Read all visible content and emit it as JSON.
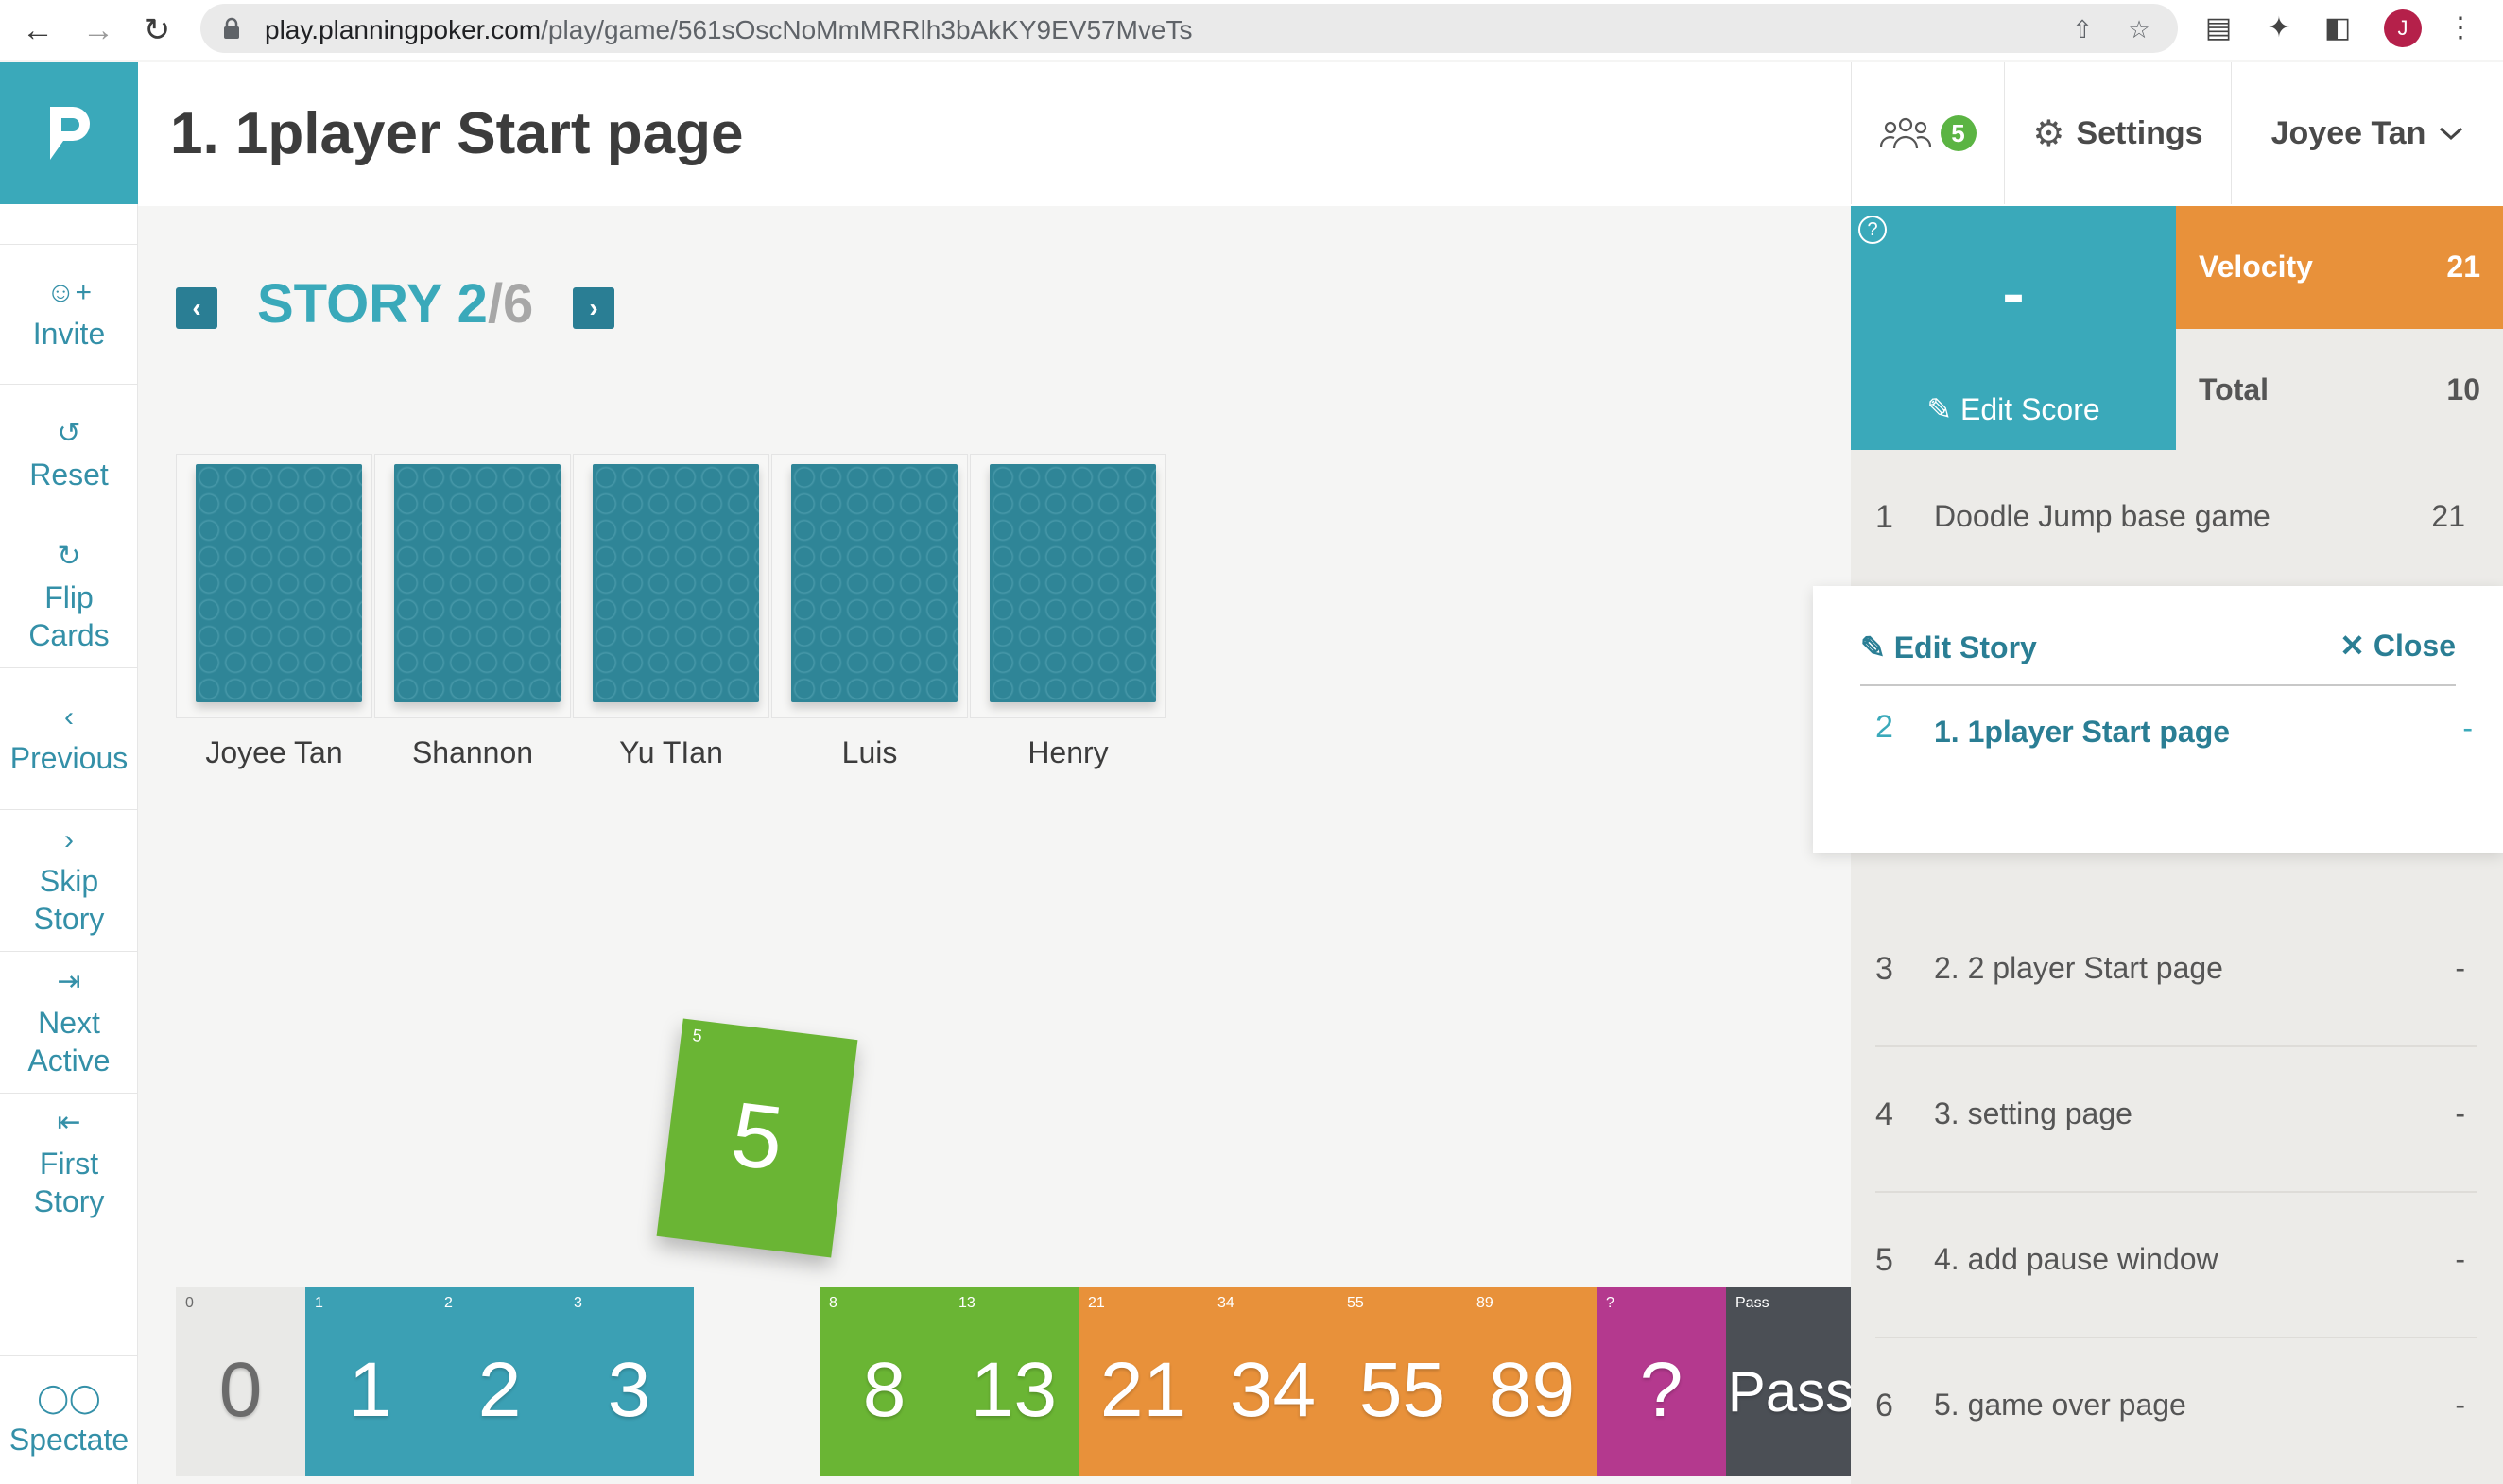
{
  "browser": {
    "url_host": "play.planningpoker.com",
    "url_path": "/play/game/561sOscNoMmMRRlh3bAkKY9EV57MveTs",
    "profile_initial": "J"
  },
  "header": {
    "title": "1. 1player Start page",
    "players_count": "5",
    "settings_label": "Settings",
    "user_name": "Joyee Tan"
  },
  "sidebar": {
    "invite": "Invite",
    "reset": "Reset",
    "flip_1": "Flip",
    "flip_2": "Cards",
    "previous": "Previous",
    "skip_1": "Skip",
    "skip_2": "Story",
    "next_1": "Next",
    "next_2": "Active",
    "first_1": "First",
    "first_2": "Story",
    "spectate": "Spectate"
  },
  "story_header": {
    "prefix": "STORY 2",
    "total": "/6"
  },
  "players": [
    {
      "name": "Joyee Tan"
    },
    {
      "name": "Shannon"
    },
    {
      "name": "Yu TIan"
    },
    {
      "name": "Luis"
    },
    {
      "name": "Henry"
    }
  ],
  "selected_card": {
    "corner": "5",
    "value": "5"
  },
  "deck": [
    {
      "corner": "0",
      "value": "0",
      "color": "#e9e9e7",
      "text": "#6b6b6b"
    },
    {
      "corner": "1",
      "value": "1",
      "color": "#3ba0b4"
    },
    {
      "corner": "2",
      "value": "2",
      "color": "#3ba0b4"
    },
    {
      "corner": "3",
      "value": "3",
      "color": "#3ba0b4"
    },
    {
      "corner": "8",
      "value": "8",
      "color": "#6ab534"
    },
    {
      "corner": "13",
      "value": "13",
      "color": "#6ab534"
    },
    {
      "corner": "21",
      "value": "21",
      "color": "#e8913a"
    },
    {
      "corner": "34",
      "value": "34",
      "color": "#e8913a"
    },
    {
      "corner": "55",
      "value": "55",
      "color": "#e8913a"
    },
    {
      "corner": "89",
      "value": "89",
      "color": "#e8913a"
    },
    {
      "corner": "?",
      "value": "?",
      "color": "#b4398e"
    },
    {
      "corner": "Pass",
      "value": "Pass",
      "color": "#4b4f55"
    }
  ],
  "score_panel": {
    "help": "?",
    "score": "-",
    "edit_score": "Edit Score",
    "velocity_label": "Velocity",
    "velocity_value": "21",
    "total_label": "Total",
    "total_value": "10"
  },
  "stories": [
    {
      "num": "1",
      "title": "Doodle Jump base game",
      "score": "21"
    },
    {
      "num": "3",
      "title": "2. 2 player Start page",
      "score": "-"
    },
    {
      "num": "4",
      "title": "3. setting page",
      "score": "-"
    },
    {
      "num": "5",
      "title": "4. add pause window",
      "score": "-"
    },
    {
      "num": "6",
      "title": "5. game over page",
      "score": "-"
    }
  ],
  "active_story": {
    "edit_label": "Edit Story",
    "close_label": "Close",
    "num": "2",
    "title": "1. 1player Start page",
    "score": "-"
  },
  "colors": {
    "teal": "#3aa9ba",
    "dark_teal": "#2a7e94",
    "orange": "#e8913a",
    "green": "#6ab534"
  }
}
